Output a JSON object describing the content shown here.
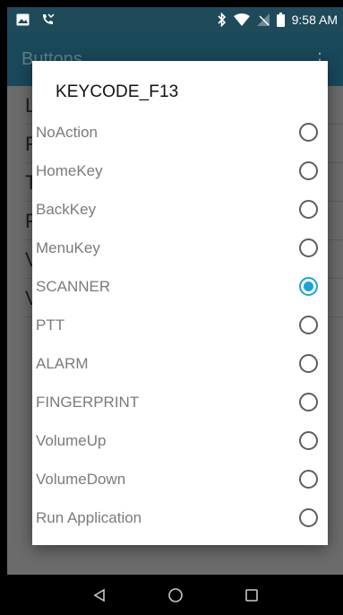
{
  "status_bar": {
    "time": "9:58 AM",
    "icons": [
      "image-notification-icon",
      "missed-call-icon",
      "bluetooth-icon",
      "wifi-icon",
      "no-signal-icon",
      "battery-icon"
    ]
  },
  "app": {
    "title": "Buttons",
    "list_initials": [
      "L",
      "F",
      "T",
      "F",
      "V",
      "V"
    ]
  },
  "dialog": {
    "title": "KEYCODE_F13",
    "options": [
      {
        "label": "NoAction",
        "selected": false
      },
      {
        "label": "HomeKey",
        "selected": false
      },
      {
        "label": "BackKey",
        "selected": false
      },
      {
        "label": "MenuKey",
        "selected": false
      },
      {
        "label": "SCANNER",
        "selected": true
      },
      {
        "label": "PTT",
        "selected": false
      },
      {
        "label": "ALARM",
        "selected": false
      },
      {
        "label": "FINGERPRINT",
        "selected": false
      },
      {
        "label": "VolumeUp",
        "selected": false
      },
      {
        "label": "VolumeDown",
        "selected": false
      },
      {
        "label": "Run Application",
        "selected": false
      }
    ]
  },
  "colors": {
    "accent": "#1aa3dd",
    "status_bar": "#1f4a59",
    "toolbar": "#19485a"
  }
}
